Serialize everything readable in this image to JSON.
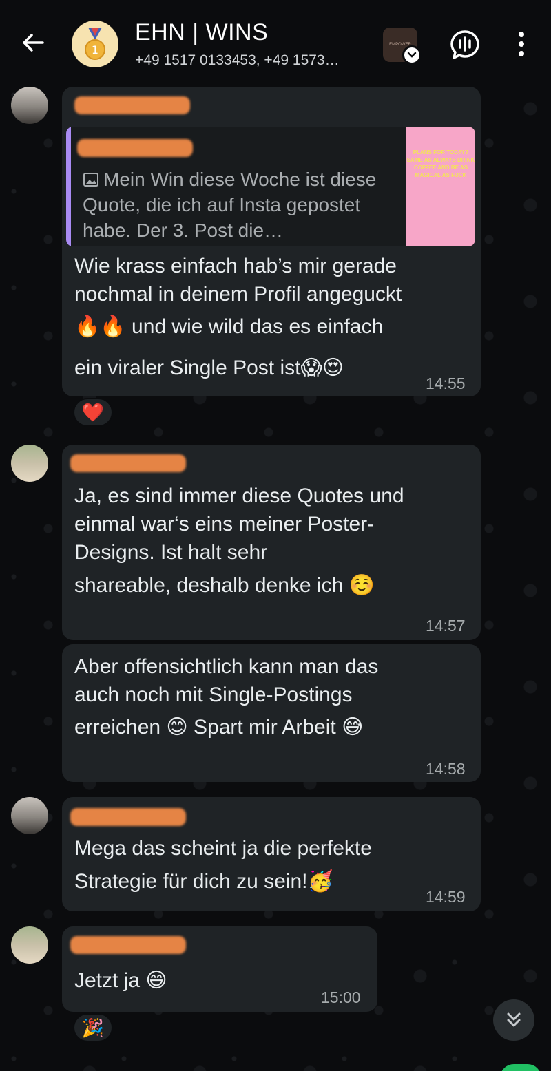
{
  "header": {
    "title": "EHN | WINS",
    "subtitle": "+49 1517 0133453, +49 1573…",
    "community_thumb_text": "EMPOWER"
  },
  "icons": {
    "back": "back-arrow-icon",
    "group_avatar": "gold-medal-icon",
    "voice_chat": "voice-chat-icon",
    "menu": "more-vertical-icon",
    "scroll_down": "double-chevron-down-icon"
  },
  "messages": [
    {
      "sender": "a",
      "quote": {
        "text": "Mein Win diese Woche ist diese Quote, die ich auf Insta gepostet habe. Der 3. Post die…",
        "image_text": "PLANS FOR TODAY? SAME AS ALWAYS DRINK COFFEE AND BE AS MAGICAL AS FUCK"
      },
      "text": "Wie krass einfach hab’s mir gerade nochmal in deinem Profil angeguckt",
      "text2": "🔥🔥 und wie wild das es einfach",
      "text3": "ein viraler Single Post ist😱😍",
      "time": "14:55",
      "reaction": "❤️"
    },
    {
      "sender": "b",
      "text": "Ja, es sind immer diese Quotes und einmal war‘s eins meiner Poster-Designs. Ist halt sehr",
      "text2": "shareable, deshalb denke ich ☺️",
      "time": "14:57"
    },
    {
      "sender": "b",
      "text": "Aber offensichtlich kann man das auch noch mit Single-Postings",
      "text2": "erreichen 😊 Spart mir Arbeit 😅",
      "time": "14:58"
    },
    {
      "sender": "a",
      "text": "Mega das scheint ja die perfekte",
      "text2": "Strategie für dich zu sein!🥳",
      "time": "14:59"
    },
    {
      "sender": "b",
      "text": "Jetzt ja 😄",
      "time": "15:00",
      "reaction": "🎉"
    }
  ]
}
